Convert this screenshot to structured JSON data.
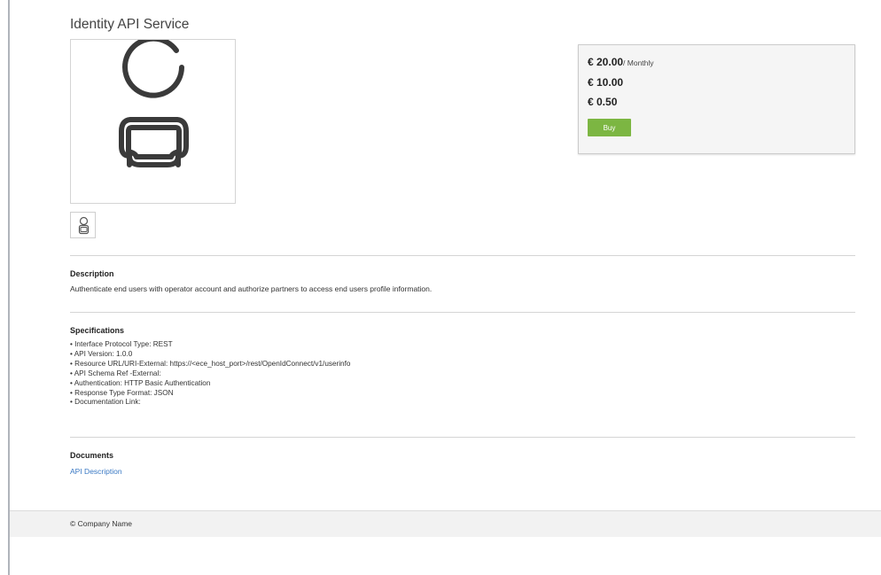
{
  "product": {
    "title": "Identity API Service",
    "image_icon": "person-holding-card-icon",
    "thumbnail_icon": "person-holding-card-icon"
  },
  "pricing": {
    "prices": [
      {
        "amount": "€ 20.00",
        "unit": "/ Monthly"
      },
      {
        "amount": "€ 10.00",
        "unit": ""
      },
      {
        "amount": "€ 0.50",
        "unit": ""
      }
    ],
    "buy_label": "Buy",
    "buy_color": "#7cb642"
  },
  "description": {
    "title": "Description",
    "text": "Authenticate end users with operator account and authorize partners to access end users profile information."
  },
  "specifications": {
    "title": "Specifications",
    "items": [
      "Interface Protocol Type: REST",
      "API Version: 1.0.0",
      "Resource URL/URI-External: https://<ece_host_port>/rest/OpenIdConnect/v1/userinfo",
      "API Schema Ref -External:",
      "Authentication: HTTP Basic Authentication",
      "Response Type Format: JSON",
      "Documentation Link:"
    ]
  },
  "documents": {
    "title": "Documents",
    "link_label": "API Description",
    "link_color": "#3a79c4"
  },
  "footer": {
    "copyright": "© Company Name"
  }
}
